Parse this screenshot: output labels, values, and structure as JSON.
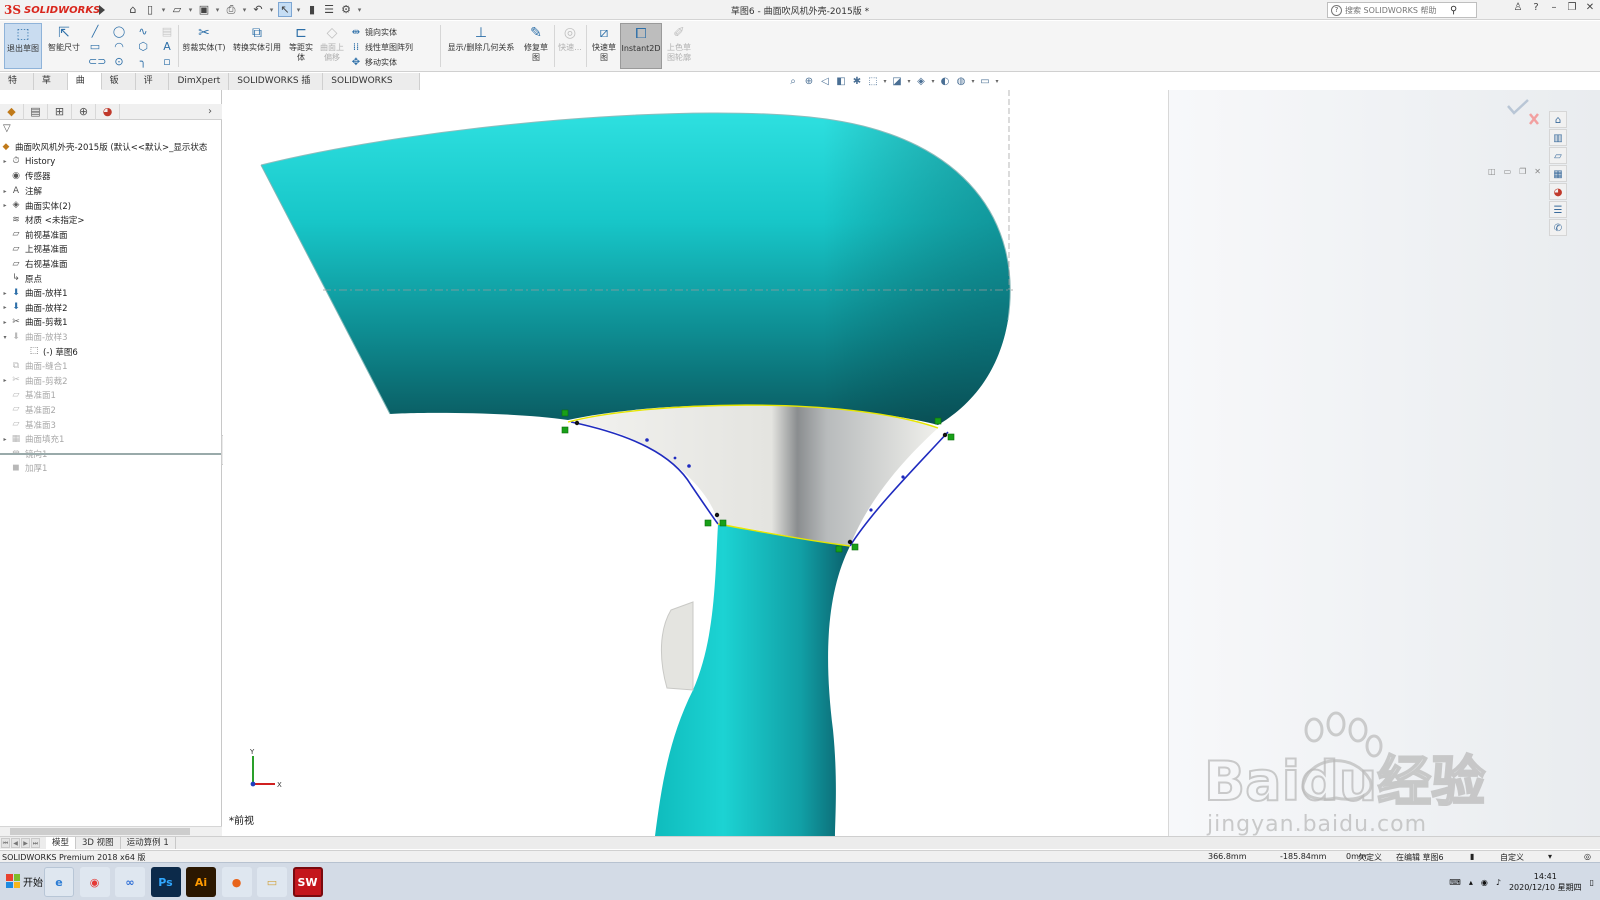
{
  "app": {
    "logo_text": "SOLIDWORKS",
    "logo_mark": "3S",
    "document_title": "草图6 - 曲面吹风机外壳-2015版 *"
  },
  "help_search": {
    "placeholder": "搜索 SOLIDWORKS 帮助"
  },
  "ribbon": {
    "exit_sketch": "退出草图",
    "smart_dimension": "智能尺寸",
    "trim_entities": "剪裁实体(T)",
    "convert_entities": "转换实体引用",
    "offset_entities": "等距实体",
    "surface_offset": "曲面上偏移",
    "mirror_entities": "镜向实体",
    "linear_pattern": "线性草图阵列",
    "move_entities": "移动实体",
    "display_relations": "显示/删除几何关系",
    "repair_sketch": "修复草图",
    "quick_snaps": "快速...",
    "rapid_sketch": "快速草图",
    "instant2d": "Instant2D",
    "shaded_sketch": "上色草图轮廓"
  },
  "command_tabs": [
    "特征",
    "草图",
    "曲面",
    "钣件",
    "评估",
    "DimXpert",
    "SOLIDWORKS 插件",
    "SOLIDWORKS MBD"
  ],
  "command_tabs_active": 2,
  "feature_tree": {
    "root": "曲面吹风机外壳-2015版  (默认<<默认>_显示状态",
    "items": [
      {
        "label": "History",
        "icon": "history-icon",
        "expand": "▸",
        "state": "normal"
      },
      {
        "label": "传感器",
        "icon": "sensor-icon",
        "expand": "",
        "state": "normal"
      },
      {
        "label": "注解",
        "icon": "annotation-icon",
        "expand": "▸",
        "state": "normal"
      },
      {
        "label": "曲面实体(2)",
        "icon": "surface-bodies-icon",
        "expand": "▸",
        "state": "normal"
      },
      {
        "label": "材质 <未指定>",
        "icon": "material-icon",
        "expand": "",
        "state": "normal"
      },
      {
        "label": "前视基准面",
        "icon": "plane-icon",
        "expand": "",
        "state": "normal"
      },
      {
        "label": "上视基准面",
        "icon": "plane-icon",
        "expand": "",
        "state": "normal"
      },
      {
        "label": "右视基准面",
        "icon": "plane-icon",
        "expand": "",
        "state": "normal"
      },
      {
        "label": "原点",
        "icon": "origin-icon",
        "expand": "",
        "state": "normal"
      },
      {
        "label": "曲面-放样1",
        "icon": "loft-icon",
        "expand": "▸",
        "state": "normal"
      },
      {
        "label": "曲面-放样2",
        "icon": "loft-icon",
        "expand": "▸",
        "state": "normal"
      },
      {
        "label": "曲面-剪裁1",
        "icon": "trim-icon",
        "expand": "▸",
        "state": "normal"
      },
      {
        "label": "曲面-放样3",
        "icon": "loft-icon",
        "expand": "▾",
        "state": "dim"
      },
      {
        "label": "(-) 草图6",
        "icon": "sketch-icon",
        "expand": "",
        "state": "child"
      },
      {
        "label": "曲面-缝合1",
        "icon": "knit-icon",
        "expand": "",
        "state": "dim"
      },
      {
        "label": "曲面-剪裁2",
        "icon": "trim-icon",
        "expand": "▸",
        "state": "dim"
      },
      {
        "label": "基准面1",
        "icon": "plane-icon",
        "expand": "",
        "state": "dim"
      },
      {
        "label": "基准面2",
        "icon": "plane-icon",
        "expand": "",
        "state": "dim"
      },
      {
        "label": "基准面3",
        "icon": "plane-icon",
        "expand": "",
        "state": "dim"
      },
      {
        "label": "曲面填充1",
        "icon": "fill-icon",
        "expand": "▸",
        "state": "dim"
      },
      {
        "label": "镜向1",
        "icon": "mirror-icon",
        "expand": "",
        "state": "dim"
      },
      {
        "label": "加厚1",
        "icon": "thicken-icon",
        "expand": "",
        "state": "dim"
      }
    ]
  },
  "viewport": {
    "view_name": "*前视",
    "triad_x": "X",
    "triad_y": "Y"
  },
  "bottom_tabs": [
    "模型",
    "3D 视图",
    "运动算例 1"
  ],
  "bottom_tabs_active": 0,
  "status": {
    "product": "SOLIDWORKS Premium 2018 x64 版",
    "x_coord": "366.8mm",
    "y_coord": "-185.84mm",
    "z_coord": "0mm",
    "definition": "欠定义",
    "editing": "在编辑 草图6",
    "units": "自定义"
  },
  "taskbar": {
    "start_label": "开始",
    "apps": [
      {
        "name": "browser-360-icon",
        "label": "e"
      },
      {
        "name": "chrome-icon",
        "label": "◉"
      },
      {
        "name": "baidu-netdisk-icon",
        "label": "∞"
      },
      {
        "name": "photoshop-icon",
        "label": "Ps"
      },
      {
        "name": "illustrator-icon",
        "label": "Ai"
      },
      {
        "name": "firefox-icon",
        "label": "●"
      },
      {
        "name": "file-explorer-icon",
        "label": "▭"
      },
      {
        "name": "solidworks-taskbar-icon",
        "label": "SW"
      }
    ],
    "time": "14:41",
    "date": "2020/12/10 星期四"
  },
  "watermark": {
    "brand": "Baidu经验",
    "url": "jingyan.baidu.com"
  },
  "colors": {
    "model_cyan": "#17c9c9",
    "model_dark": "#0a5f63",
    "sketch_blue": "#1f2bbf",
    "sketch_yellow": "#e6e600",
    "relation_green": "#18a018",
    "brand_red": "#d9261c"
  }
}
